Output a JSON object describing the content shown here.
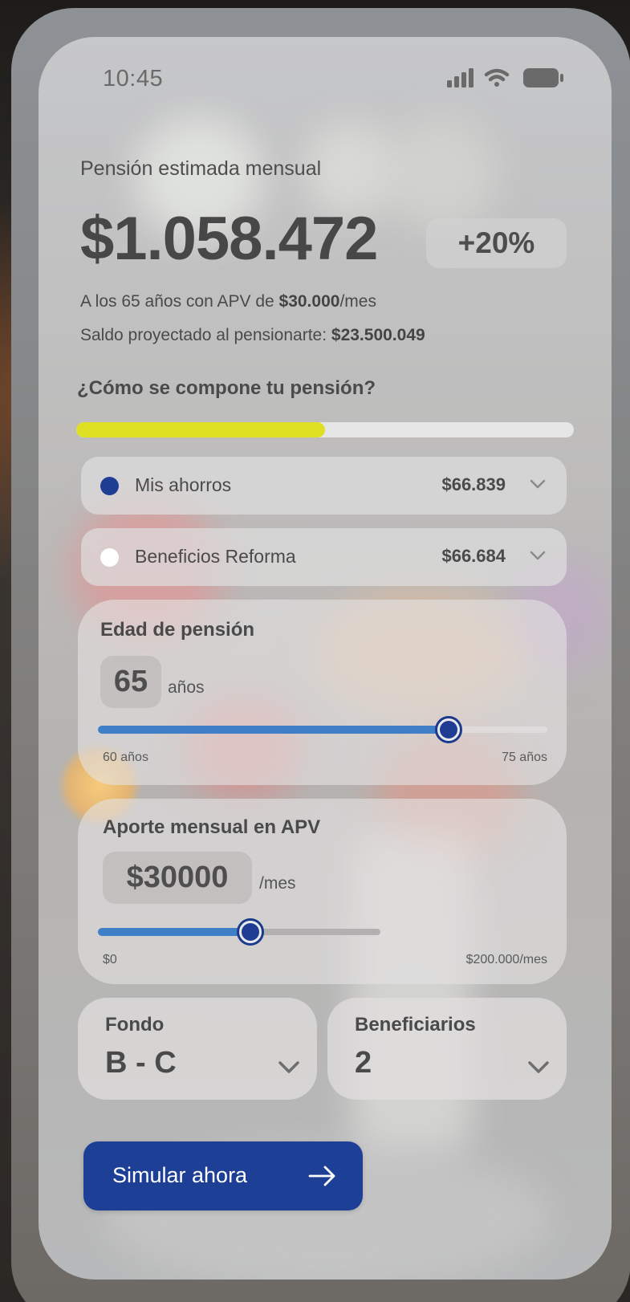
{
  "status_bar": {
    "time": "10:45",
    "icons": [
      "cellular-signal-icon",
      "wifi-icon",
      "battery-icon"
    ]
  },
  "summary": {
    "label": "Pensión estimada mensual",
    "amount": "$1.058.472",
    "change_badge": "+20%",
    "line1_prefix": "A los 65 años con APV de ",
    "line1_value": "$30.000",
    "line1_suffix": "/mes",
    "line2_prefix": "Saldo proyectado al pensionarte: ",
    "line2_value": "$23.500.049"
  },
  "composition": {
    "title": "¿Cómo se compone tu pensión?",
    "bar_fill_fraction": 0.5,
    "bar_fill_color": "#dfe023",
    "bar_track_color": "#e6e6e6",
    "items": [
      {
        "label": "Mis ahorros",
        "value": "$66.839",
        "dot_color": "#1f3d92",
        "icon": "chevron-down-icon"
      },
      {
        "label": "Beneficios Reforma",
        "value": "$66.684",
        "dot_color": "#ffffff",
        "icon": "chevron-down-icon"
      }
    ]
  },
  "retirement_age": {
    "title": "Edad de pensión",
    "value": "65",
    "unit": "años",
    "min_label": "60 años",
    "max_label": "75 años",
    "level_fraction": 0.78
  },
  "monthly_apv": {
    "title": "Aporte mensual en APV",
    "value": "$30000",
    "unit": "/mes",
    "min_label": "$0",
    "max_label": "$200.000/mes",
    "level_fraction": 0.54
  },
  "fund": {
    "label": "Fondo",
    "value": "B - C",
    "icon": "chevron-down-icon"
  },
  "beneficiaries": {
    "label": "Beneficiarios",
    "value": "2",
    "icon": "chevron-down-icon"
  },
  "cta": {
    "label": "Simular ahora",
    "icon": "arrow-right-icon",
    "background": "#1d3f95"
  },
  "colors": {
    "accent_blue": "#1f3d92",
    "slider_blue": "#3f7fc8",
    "highlight_yellow": "#dfe023"
  }
}
